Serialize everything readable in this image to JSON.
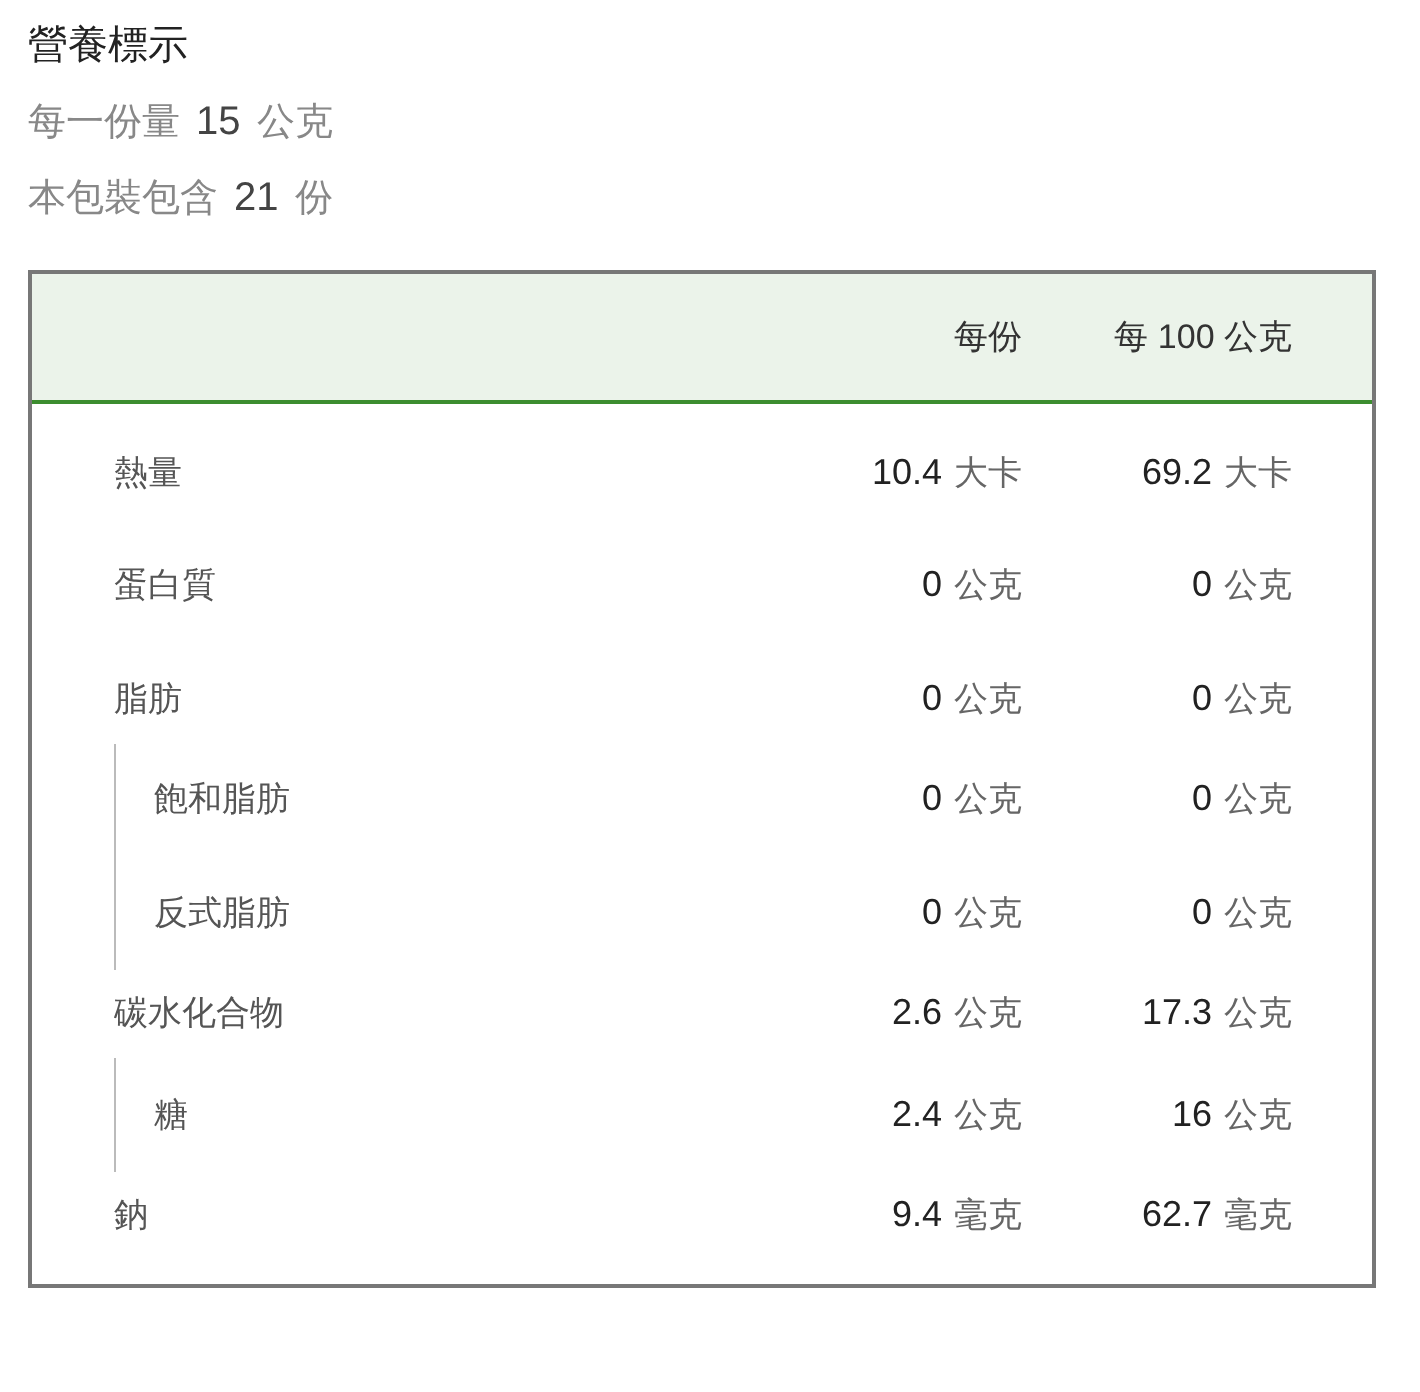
{
  "title": "營養標示",
  "serving_lines": [
    {
      "label": "每一份量",
      "amount": "15",
      "unit": "公克"
    },
    {
      "label": "本包裝包含",
      "amount": "21",
      "unit": "份"
    }
  ],
  "table": {
    "columns": [
      "每份",
      "每 100 公克"
    ],
    "rows": [
      {
        "name": "熱量",
        "values": [
          {
            "amount": "10.4",
            "unit": "大卡"
          },
          {
            "amount": "69.2",
            "unit": "大卡"
          }
        ]
      },
      {
        "name": "蛋白質",
        "values": [
          {
            "amount": "0",
            "unit": "公克"
          },
          {
            "amount": "0",
            "unit": "公克"
          }
        ]
      },
      {
        "name": "脂肪",
        "values": [
          {
            "amount": "0",
            "unit": "公克"
          },
          {
            "amount": "0",
            "unit": "公克"
          }
        ],
        "children": [
          {
            "name": "飽和脂肪",
            "values": [
              {
                "amount": "0",
                "unit": "公克"
              },
              {
                "amount": "0",
                "unit": "公克"
              }
            ]
          },
          {
            "name": "反式脂肪",
            "values": [
              {
                "amount": "0",
                "unit": "公克"
              },
              {
                "amount": "0",
                "unit": "公克"
              }
            ]
          }
        ]
      },
      {
        "name": "碳水化合物",
        "values": [
          {
            "amount": "2.6",
            "unit": "公克"
          },
          {
            "amount": "17.3",
            "unit": "公克"
          }
        ],
        "children": [
          {
            "name": "糖",
            "values": [
              {
                "amount": "2.4",
                "unit": "公克"
              },
              {
                "amount": "16",
                "unit": "公克"
              }
            ]
          }
        ]
      },
      {
        "name": "鈉",
        "values": [
          {
            "amount": "9.4",
            "unit": "毫克"
          },
          {
            "amount": "62.7",
            "unit": "毫克"
          }
        ]
      }
    ]
  }
}
